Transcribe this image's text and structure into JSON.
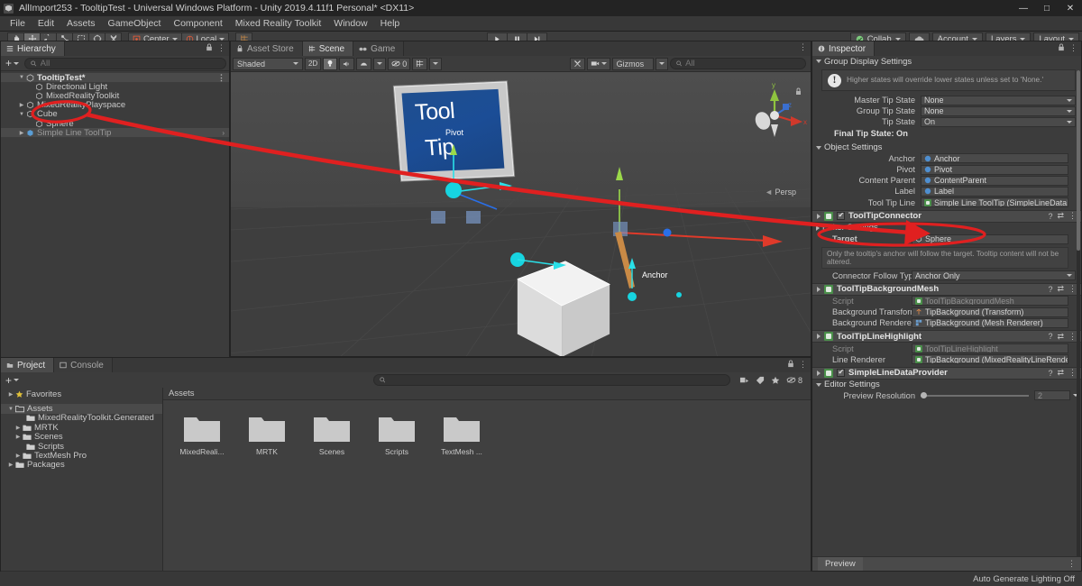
{
  "titlebar": {
    "title": "AllImport253 - TooltipTest - Universal Windows Platform - Unity 2019.4.11f1 Personal* <DX11>",
    "minimize": "—",
    "maximize": "□",
    "close": "✕"
  },
  "menubar": {
    "items": [
      {
        "label": "File"
      },
      {
        "label": "Edit"
      },
      {
        "label": "Assets"
      },
      {
        "label": "GameObject"
      },
      {
        "label": "Component"
      },
      {
        "label": "Mixed Reality Toolkit"
      },
      {
        "label": "Window"
      },
      {
        "label": "Help"
      }
    ]
  },
  "toolbar": {
    "tools": [
      {
        "name": "hand-tool",
        "active": false
      },
      {
        "name": "move-tool",
        "active": true
      },
      {
        "name": "rotate-tool",
        "active": false
      },
      {
        "name": "scale-tool",
        "active": false
      },
      {
        "name": "rect-tool",
        "active": false
      },
      {
        "name": "transform-tool",
        "active": false
      },
      {
        "name": "custom-tool",
        "active": false
      }
    ],
    "pivot_mode": "Center",
    "pivot_rotation": "Local",
    "play": "▶",
    "pause": "❙❙",
    "step": "▶❙",
    "collab": "Collab",
    "account": "Account",
    "layers": "Layers",
    "layout": "Layout"
  },
  "hierarchy": {
    "tab_label": "Hierarchy",
    "search_placeholder": "All",
    "add_label": "+",
    "items": [
      {
        "label": "TooltipTest*",
        "depth": 0,
        "type": "scene",
        "expanded": true,
        "selected": false
      },
      {
        "label": "Directional Light",
        "depth": 1,
        "type": "gameobject",
        "expanded": null,
        "selected": false
      },
      {
        "label": "MixedRealityToolkit",
        "depth": 1,
        "type": "gameobject",
        "expanded": null,
        "selected": false
      },
      {
        "label": "MixedRealityPlayspace",
        "depth": 1,
        "type": "gameobject",
        "expanded": false,
        "selected": false
      },
      {
        "label": "Cube",
        "depth": 1,
        "type": "gameobject",
        "expanded": true,
        "selected": false
      },
      {
        "label": "Sphere",
        "depth": 2,
        "type": "gameobject",
        "expanded": null,
        "selected": false
      },
      {
        "label": "Simple Line ToolTip",
        "depth": 1,
        "type": "prefab",
        "expanded": false,
        "selected": true
      }
    ]
  },
  "sceneview": {
    "tabs": [
      {
        "label": "Asset Store",
        "icon": "store-icon",
        "active": false
      },
      {
        "label": "Scene",
        "icon": "scene-icon",
        "active": true
      },
      {
        "label": "Game",
        "icon": "game-icon",
        "active": false
      }
    ],
    "draw_mode": "Shaded",
    "two_d": "2D",
    "gizmos_label": "Gizmos",
    "gizmos_search_placeholder": "All",
    "effects_count": "0",
    "labels": {
      "pivot": "Pivot",
      "anchor": "Anchor",
      "tooltip_line1": "Tool",
      "tooltip_line2": "Tip"
    },
    "gizmo": {
      "x": "x",
      "y": "y",
      "z": "z",
      "projection": "Persp"
    }
  },
  "project": {
    "tabs": [
      {
        "label": "Project",
        "active": true
      },
      {
        "label": "Console",
        "active": false
      }
    ],
    "add_label": "+",
    "search_placeholder": "",
    "filter_count": "8",
    "tree": [
      {
        "label": "Favorites",
        "depth": 0,
        "type": "favorite",
        "expanded": false,
        "selected": false
      },
      {
        "label": "Assets",
        "depth": 0,
        "type": "folder",
        "expanded": true,
        "selected": true
      },
      {
        "label": "MixedRealityToolkit.Generated",
        "depth": 1,
        "type": "folder",
        "expanded": null,
        "selected": false
      },
      {
        "label": "MRTK",
        "depth": 1,
        "type": "folder",
        "expanded": false,
        "selected": false
      },
      {
        "label": "Scenes",
        "depth": 1,
        "type": "folder",
        "expanded": false,
        "selected": false
      },
      {
        "label": "Scripts",
        "depth": 1,
        "type": "folder",
        "expanded": null,
        "selected": false
      },
      {
        "label": "TextMesh Pro",
        "depth": 1,
        "type": "folder",
        "expanded": false,
        "selected": false
      },
      {
        "label": "Packages",
        "depth": 0,
        "type": "folder",
        "expanded": false,
        "selected": false
      }
    ],
    "breadcrumb": "Assets",
    "assets": [
      {
        "label": "MixedReali...",
        "type": "folder"
      },
      {
        "label": "MRTK",
        "type": "folder"
      },
      {
        "label": "Scenes",
        "type": "folder"
      },
      {
        "label": "Scripts",
        "type": "folder"
      },
      {
        "label": "TextMesh ...",
        "type": "folder"
      }
    ]
  },
  "inspector": {
    "tab_label": "Inspector",
    "group_display_settings": {
      "title": "Group Display Settings",
      "warning": "Higher states will override lower states unless set to 'None.'",
      "rows": [
        {
          "label": "Master Tip State",
          "value": "None"
        },
        {
          "label": "Group Tip State",
          "value": "None"
        },
        {
          "label": "Tip State",
          "value": "On"
        }
      ],
      "final_state": "Final Tip State: On"
    },
    "object_settings": {
      "title": "Object Settings",
      "rows": [
        {
          "label": "Anchor",
          "value": "Anchor",
          "icon": "gameobject-icon"
        },
        {
          "label": "Pivot",
          "value": "Pivot",
          "icon": "gameobject-icon"
        },
        {
          "label": "Content Parent",
          "value": "ContentParent",
          "icon": "gameobject-icon"
        },
        {
          "label": "Label",
          "value": "Label",
          "icon": "gameobject-icon"
        },
        {
          "label": "Tool Tip Line",
          "value": "Simple Line ToolTip (SimpleLineDataProv",
          "icon": "script-icon"
        }
      ]
    },
    "components": [
      {
        "name": "ToolTipConnector",
        "enabled": true,
        "editor_settings": "Editor Settings",
        "rows": [
          {
            "label": "Target",
            "value": "Sphere",
            "icon": "gameobject-icon",
            "highlighted": true
          }
        ],
        "help": "Only the tooltip's anchor will follow the target. Tooltip content will not be altered.",
        "dropdowns": [
          {
            "label": "Connector Follow Type",
            "value": "Anchor Only"
          }
        ]
      },
      {
        "name": "ToolTipBackgroundMesh",
        "enabled": null,
        "rows": [
          {
            "label": "Script",
            "value": "ToolTipBackgroundMesh",
            "icon": "script-icon",
            "dim": true
          },
          {
            "label": "Background Transform",
            "value": "TipBackground (Transform)",
            "icon": "transform-icon"
          },
          {
            "label": "Background Renderer",
            "value": "TipBackground (Mesh Renderer)",
            "icon": "mesh-icon"
          }
        ]
      },
      {
        "name": "ToolTipLineHighlight",
        "enabled": null,
        "rows": [
          {
            "label": "Script",
            "value": "ToolTipLineHighlight",
            "icon": "script-icon",
            "dim": true
          },
          {
            "label": "Line Renderer",
            "value": "TipBackground (MixedRealityLineRender",
            "icon": "script-icon"
          }
        ]
      },
      {
        "name": "SimpleLineDataProvider",
        "enabled": true,
        "editor_settings": "Editor Settings",
        "slider": {
          "label": "Preview Resolution",
          "value": "2"
        }
      }
    ],
    "preview_label": "Preview"
  },
  "statusbar": {
    "message": "Auto Generate Lighting Off"
  },
  "colors": {
    "annotation_red": "#e02020",
    "accent_cyan": "#17d4e0",
    "selection": "#4a4a4a",
    "panel_bg": "#3c3c3c"
  }
}
